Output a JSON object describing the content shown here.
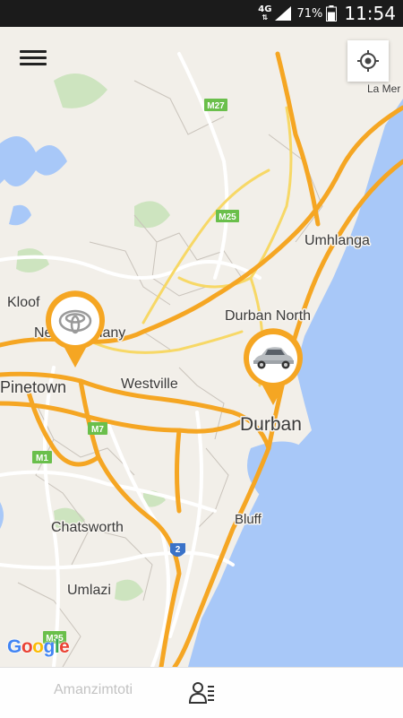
{
  "status_bar": {
    "network": "4G",
    "battery_percent": "71%",
    "time": "11:54",
    "battery_level": 0.71
  },
  "map": {
    "labels": {
      "la_mercy": "La Mer",
      "m27": "M27",
      "m25": "M25",
      "umhlanga": "Umhlanga",
      "kloof": "Kloof",
      "new_germany": "New Germany",
      "durban_north": "Durban North",
      "pinetown": "Pinetown",
      "westville": "Westville",
      "m7": "M7",
      "durban": "Durban",
      "m1": "M1",
      "bluff": "Bluff",
      "chatsworth": "Chatsworth",
      "n2": "2",
      "umlazi": "Umlazi",
      "m35": "M35",
      "amanzimtoti": "Amanzimtoti"
    },
    "attribution": "Google",
    "colors": {
      "land": "#f2efe9",
      "water": "#a8c8f8",
      "highway": "#f5a623",
      "green": "#cde4bf",
      "route_shield": "#6abf4b"
    }
  },
  "markers": [
    {
      "name": "toyota-marker",
      "icon": "toyota-logo"
    },
    {
      "name": "car-marker",
      "icon": "silver-car"
    }
  ],
  "bottom_bar": {
    "contacts_icon": "contacts-list-icon"
  }
}
